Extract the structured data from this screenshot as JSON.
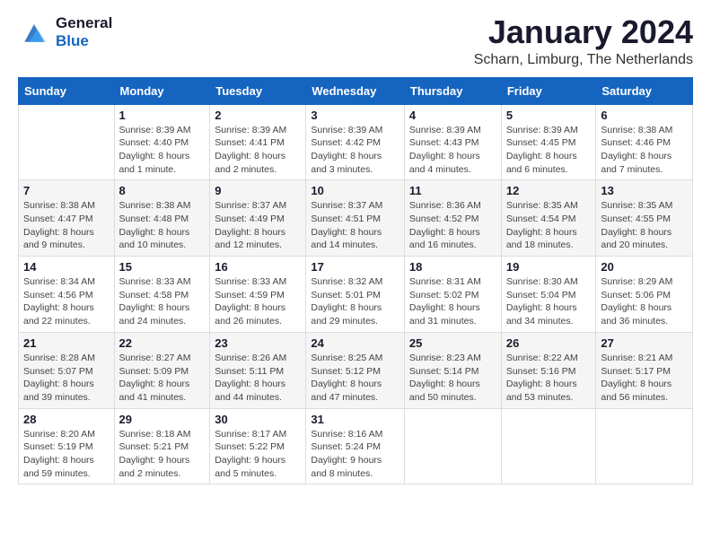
{
  "header": {
    "logo": {
      "general": "General",
      "blue": "Blue"
    },
    "month": "January 2024",
    "location": "Scharn, Limburg, The Netherlands"
  },
  "weekdays": [
    "Sunday",
    "Monday",
    "Tuesday",
    "Wednesday",
    "Thursday",
    "Friday",
    "Saturday"
  ],
  "weeks": [
    [
      {
        "day": "",
        "sunrise": "",
        "sunset": "",
        "daylight": ""
      },
      {
        "day": "1",
        "sunrise": "Sunrise: 8:39 AM",
        "sunset": "Sunset: 4:40 PM",
        "daylight": "Daylight: 8 hours and 1 minute."
      },
      {
        "day": "2",
        "sunrise": "Sunrise: 8:39 AM",
        "sunset": "Sunset: 4:41 PM",
        "daylight": "Daylight: 8 hours and 2 minutes."
      },
      {
        "day": "3",
        "sunrise": "Sunrise: 8:39 AM",
        "sunset": "Sunset: 4:42 PM",
        "daylight": "Daylight: 8 hours and 3 minutes."
      },
      {
        "day": "4",
        "sunrise": "Sunrise: 8:39 AM",
        "sunset": "Sunset: 4:43 PM",
        "daylight": "Daylight: 8 hours and 4 minutes."
      },
      {
        "day": "5",
        "sunrise": "Sunrise: 8:39 AM",
        "sunset": "Sunset: 4:45 PM",
        "daylight": "Daylight: 8 hours and 6 minutes."
      },
      {
        "day": "6",
        "sunrise": "Sunrise: 8:38 AM",
        "sunset": "Sunset: 4:46 PM",
        "daylight": "Daylight: 8 hours and 7 minutes."
      }
    ],
    [
      {
        "day": "7",
        "sunrise": "Sunrise: 8:38 AM",
        "sunset": "Sunset: 4:47 PM",
        "daylight": "Daylight: 8 hours and 9 minutes."
      },
      {
        "day": "8",
        "sunrise": "Sunrise: 8:38 AM",
        "sunset": "Sunset: 4:48 PM",
        "daylight": "Daylight: 8 hours and 10 minutes."
      },
      {
        "day": "9",
        "sunrise": "Sunrise: 8:37 AM",
        "sunset": "Sunset: 4:49 PM",
        "daylight": "Daylight: 8 hours and 12 minutes."
      },
      {
        "day": "10",
        "sunrise": "Sunrise: 8:37 AM",
        "sunset": "Sunset: 4:51 PM",
        "daylight": "Daylight: 8 hours and 14 minutes."
      },
      {
        "day": "11",
        "sunrise": "Sunrise: 8:36 AM",
        "sunset": "Sunset: 4:52 PM",
        "daylight": "Daylight: 8 hours and 16 minutes."
      },
      {
        "day": "12",
        "sunrise": "Sunrise: 8:35 AM",
        "sunset": "Sunset: 4:54 PM",
        "daylight": "Daylight: 8 hours and 18 minutes."
      },
      {
        "day": "13",
        "sunrise": "Sunrise: 8:35 AM",
        "sunset": "Sunset: 4:55 PM",
        "daylight": "Daylight: 8 hours and 20 minutes."
      }
    ],
    [
      {
        "day": "14",
        "sunrise": "Sunrise: 8:34 AM",
        "sunset": "Sunset: 4:56 PM",
        "daylight": "Daylight: 8 hours and 22 minutes."
      },
      {
        "day": "15",
        "sunrise": "Sunrise: 8:33 AM",
        "sunset": "Sunset: 4:58 PM",
        "daylight": "Daylight: 8 hours and 24 minutes."
      },
      {
        "day": "16",
        "sunrise": "Sunrise: 8:33 AM",
        "sunset": "Sunset: 4:59 PM",
        "daylight": "Daylight: 8 hours and 26 minutes."
      },
      {
        "day": "17",
        "sunrise": "Sunrise: 8:32 AM",
        "sunset": "Sunset: 5:01 PM",
        "daylight": "Daylight: 8 hours and 29 minutes."
      },
      {
        "day": "18",
        "sunrise": "Sunrise: 8:31 AM",
        "sunset": "Sunset: 5:02 PM",
        "daylight": "Daylight: 8 hours and 31 minutes."
      },
      {
        "day": "19",
        "sunrise": "Sunrise: 8:30 AM",
        "sunset": "Sunset: 5:04 PM",
        "daylight": "Daylight: 8 hours and 34 minutes."
      },
      {
        "day": "20",
        "sunrise": "Sunrise: 8:29 AM",
        "sunset": "Sunset: 5:06 PM",
        "daylight": "Daylight: 8 hours and 36 minutes."
      }
    ],
    [
      {
        "day": "21",
        "sunrise": "Sunrise: 8:28 AM",
        "sunset": "Sunset: 5:07 PM",
        "daylight": "Daylight: 8 hours and 39 minutes."
      },
      {
        "day": "22",
        "sunrise": "Sunrise: 8:27 AM",
        "sunset": "Sunset: 5:09 PM",
        "daylight": "Daylight: 8 hours and 41 minutes."
      },
      {
        "day": "23",
        "sunrise": "Sunrise: 8:26 AM",
        "sunset": "Sunset: 5:11 PM",
        "daylight": "Daylight: 8 hours and 44 minutes."
      },
      {
        "day": "24",
        "sunrise": "Sunrise: 8:25 AM",
        "sunset": "Sunset: 5:12 PM",
        "daylight": "Daylight: 8 hours and 47 minutes."
      },
      {
        "day": "25",
        "sunrise": "Sunrise: 8:23 AM",
        "sunset": "Sunset: 5:14 PM",
        "daylight": "Daylight: 8 hours and 50 minutes."
      },
      {
        "day": "26",
        "sunrise": "Sunrise: 8:22 AM",
        "sunset": "Sunset: 5:16 PM",
        "daylight": "Daylight: 8 hours and 53 minutes."
      },
      {
        "day": "27",
        "sunrise": "Sunrise: 8:21 AM",
        "sunset": "Sunset: 5:17 PM",
        "daylight": "Daylight: 8 hours and 56 minutes."
      }
    ],
    [
      {
        "day": "28",
        "sunrise": "Sunrise: 8:20 AM",
        "sunset": "Sunset: 5:19 PM",
        "daylight": "Daylight: 8 hours and 59 minutes."
      },
      {
        "day": "29",
        "sunrise": "Sunrise: 8:18 AM",
        "sunset": "Sunset: 5:21 PM",
        "daylight": "Daylight: 9 hours and 2 minutes."
      },
      {
        "day": "30",
        "sunrise": "Sunrise: 8:17 AM",
        "sunset": "Sunset: 5:22 PM",
        "daylight": "Daylight: 9 hours and 5 minutes."
      },
      {
        "day": "31",
        "sunrise": "Sunrise: 8:16 AM",
        "sunset": "Sunset: 5:24 PM",
        "daylight": "Daylight: 9 hours and 8 minutes."
      },
      {
        "day": "",
        "sunrise": "",
        "sunset": "",
        "daylight": ""
      },
      {
        "day": "",
        "sunrise": "",
        "sunset": "",
        "daylight": ""
      },
      {
        "day": "",
        "sunrise": "",
        "sunset": "",
        "daylight": ""
      }
    ]
  ]
}
